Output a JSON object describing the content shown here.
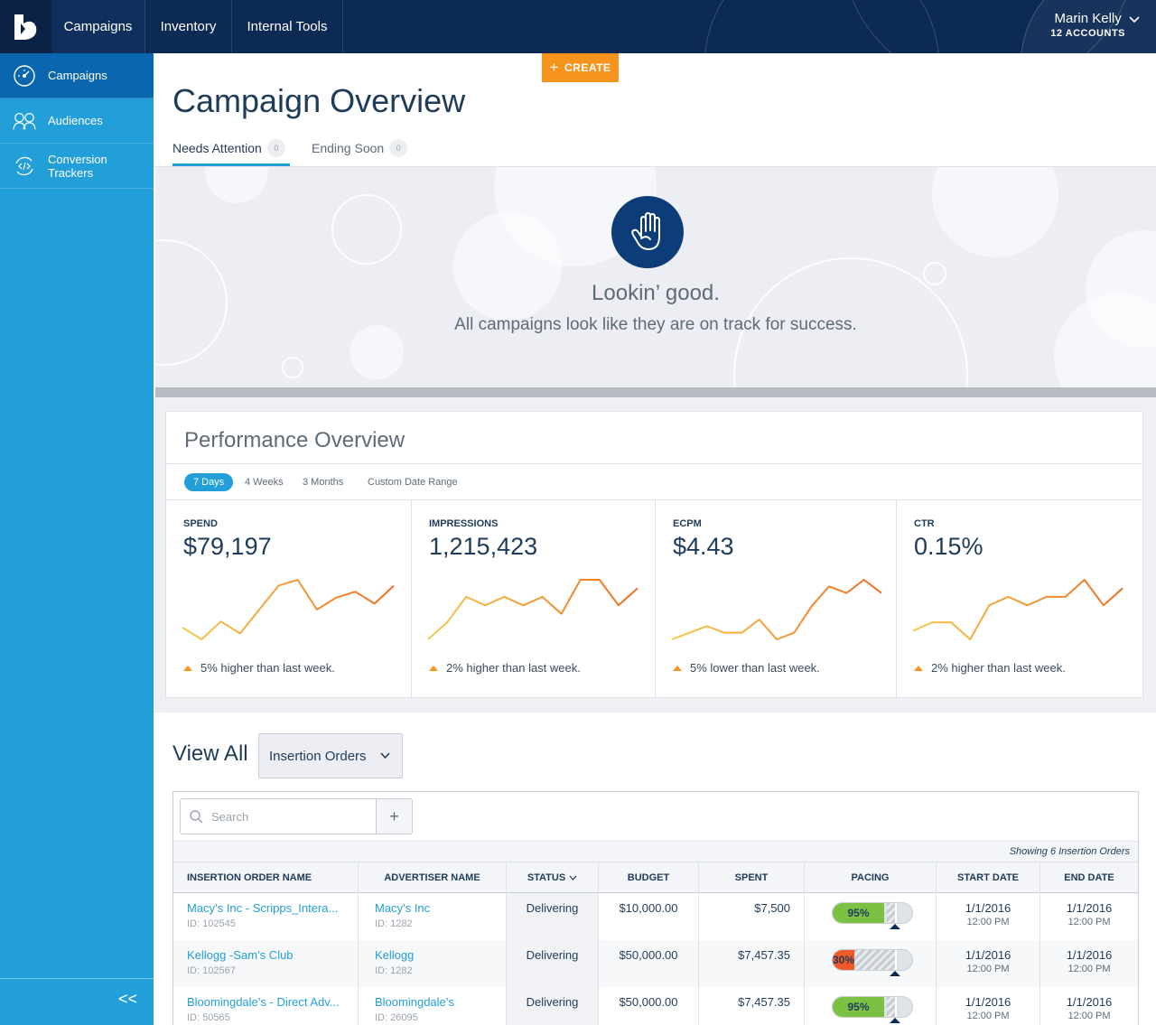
{
  "topnav": {
    "items": [
      "Campaigns",
      "Inventory",
      "Internal Tools"
    ],
    "user_name": "Marin Kelly",
    "accounts": "12 ACCOUNTS"
  },
  "sidebar": {
    "items": [
      {
        "label": "Campaigns",
        "icon": "gauge-icon"
      },
      {
        "label": "Audiences",
        "icon": "people-icon"
      },
      {
        "label": "Conversion Trackers",
        "icon": "code-sync-icon"
      }
    ],
    "collapse_label": "<<"
  },
  "create_label": "CREATE",
  "page_title": "Campaign Overview",
  "tabs": [
    {
      "label": "Needs Attention",
      "count": "0"
    },
    {
      "label": "Ending Soon",
      "count": "0"
    }
  ],
  "attention": {
    "title": "Lookin’ good.",
    "subtitle": "All campaigns look like they are on track for success."
  },
  "performance": {
    "title": "Performance Overview",
    "ranges": [
      "7 Days",
      "4 Weeks",
      "3 Months",
      "Custom Date Range"
    ],
    "metrics": [
      {
        "label": "SPEND",
        "value": "$79,197",
        "note": "5% higher than last week.",
        "trend": [
          3,
          1,
          4,
          2,
          6,
          10,
          11,
          6,
          8,
          9,
          7,
          10
        ]
      },
      {
        "label": "IMPRESSIONS",
        "value": "1,215,423",
        "note": "2% higher than last week.",
        "trend": [
          2,
          4,
          7,
          6,
          7,
          6,
          7,
          5,
          9,
          9,
          6,
          8
        ]
      },
      {
        "label": "ECPM",
        "value": "$4.43",
        "note": "5% lower than last week.",
        "trend": [
          2,
          3,
          4,
          3,
          3,
          5,
          2,
          3,
          7,
          10,
          9,
          11,
          9
        ]
      },
      {
        "label": "CTR",
        "value": "0.15%",
        "note": "2% higher than last week.",
        "trend": [
          3,
          4,
          4,
          2,
          6,
          7,
          6,
          7,
          7,
          9,
          6,
          8
        ]
      }
    ]
  },
  "view_all": {
    "label": "View All",
    "selected": "Insertion Orders"
  },
  "table": {
    "search_placeholder": "Search",
    "add_label": "+",
    "showing": "Showing 6 Insertion Orders",
    "columns": [
      "INSERTION ORDER NAME",
      "ADVERTISER NAME",
      "STATUS",
      "BUDGET",
      "SPENT",
      "PACING",
      "START DATE",
      "END DATE"
    ],
    "rows": [
      {
        "io_name": "Macy’s Inc - Scripps_Intera...",
        "io_id": "ID: 102545",
        "adv": "Macy’s Inc",
        "adv_id": "ID: 1282",
        "status": "Delivering",
        "budget": "$10,000.00",
        "spent": "$7,500",
        "pacing": "95%",
        "pacing_value": 0.65,
        "pacing_color": "#7dc142",
        "start": "1/1/2016",
        "start_time": "12:00 PM",
        "end": "1/1/2016",
        "end_time": "12:00 PM"
      },
      {
        "io_name": "Kellogg -Sam’s Club",
        "io_id": "ID: 102567",
        "adv": "Kellogg",
        "adv_id": "ID: 1282",
        "status": "Delivering",
        "budget": "$50,000.00",
        "spent": "$7,457.35",
        "pacing": "30%",
        "pacing_value": 0.27,
        "pacing_color": "#ef5a28",
        "start": "1/1/2016",
        "start_time": "12:00 PM",
        "end": "1/1/2016",
        "end_time": "12:00 PM"
      },
      {
        "io_name": "Bloomingdale’s - Direct Adv...",
        "io_id": "ID: 50565",
        "adv": "Bloomingdale’s",
        "adv_id": "ID: 26095",
        "status": "Delivering",
        "budget": "$50,000.00",
        "spent": "$7,457.35",
        "pacing": "95%",
        "pacing_value": 0.65,
        "pacing_color": "#7dc142",
        "start": "1/1/2016",
        "start_time": "12:00 PM",
        "end": "1/1/2016",
        "end_time": "12:00 PM"
      }
    ]
  },
  "colors": {
    "accent_blue": "#229fd8",
    "navy": "#0d2a54",
    "orange": "#f7941d"
  }
}
